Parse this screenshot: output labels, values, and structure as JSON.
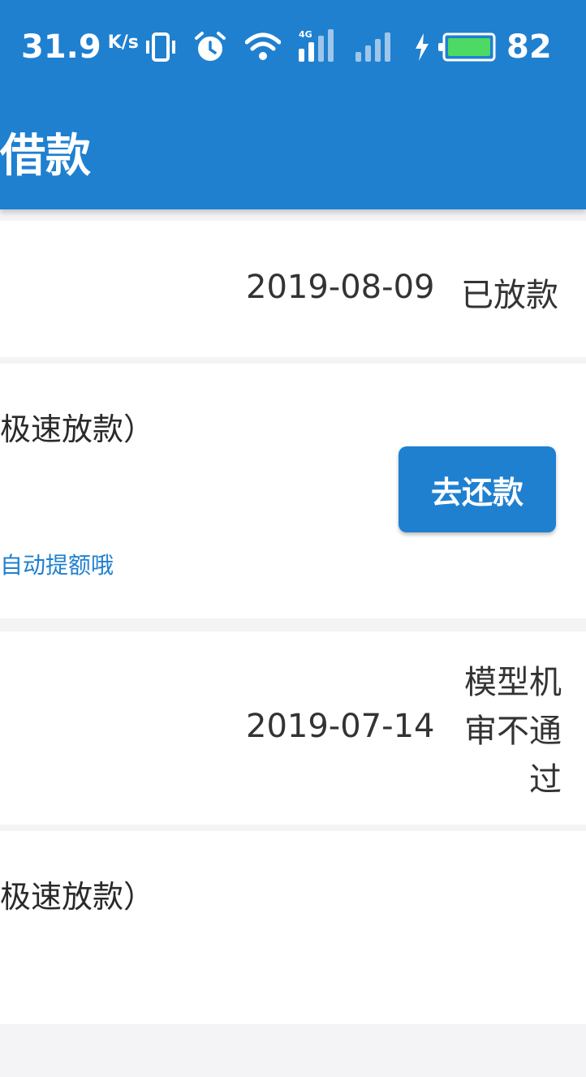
{
  "status_bar": {
    "net_speed": "31.9",
    "net_speed_unit": "K/s",
    "battery_level": "82",
    "icons": [
      "vibrate-icon",
      "alarm-icon",
      "wifi-icon",
      "signal-4g-icon",
      "signal-icon",
      "charging-icon",
      "battery-icon"
    ]
  },
  "header": {
    "title": "借款"
  },
  "records": [
    {
      "date": "2019-08-09",
      "status": "已放款"
    },
    {
      "product": "极速放款）",
      "button_label": "去还款",
      "hint": "自动提额哦"
    },
    {
      "date": "2019-07-14",
      "status_lines": [
        "模型机",
        "审不通",
        "过"
      ]
    },
    {
      "product": "极速放款）"
    }
  ],
  "colors": {
    "primary": "#1f80d0",
    "background": "#f4f4f6",
    "card": "#ffffff",
    "battery_fill": "#4cd964"
  }
}
